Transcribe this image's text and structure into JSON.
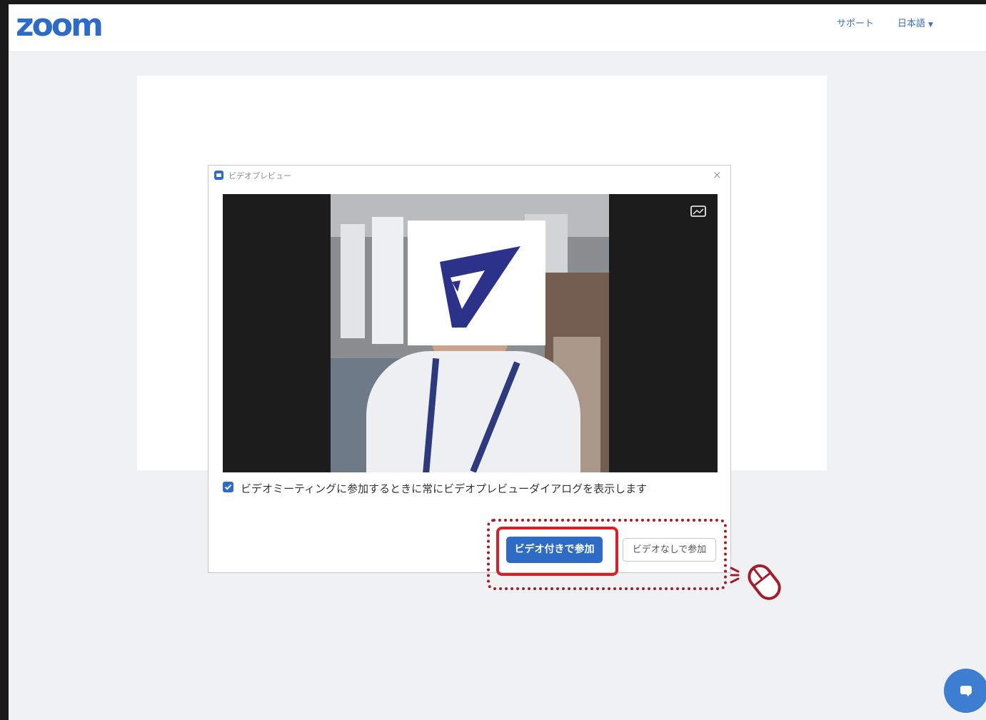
{
  "header": {
    "logo": "zoom",
    "nav_support": "サポート",
    "nav_language": "日本語"
  },
  "dialog": {
    "title": "ビデオプレビュー",
    "checkbox_label": "ビデオミーティングに参加するときに常にビデオプレビューダイアログを表示します",
    "checkbox_checked": true,
    "join_with_video": "ビデオ付きで参加",
    "join_without_video": "ビデオなしで参加"
  },
  "colors": {
    "brand_blue": "#2d6bc4",
    "highlight_red": "#d62027",
    "annotation_red": "#a31d2b"
  },
  "icons": {
    "app": "zoom-app-icon",
    "close": "close-icon",
    "pip": "picture-in-picture-icon",
    "check": "checkmark-icon",
    "chat": "chat-bubble-icon",
    "mouse": "mouse-click-icon",
    "dropdown": "caret-down-icon"
  }
}
